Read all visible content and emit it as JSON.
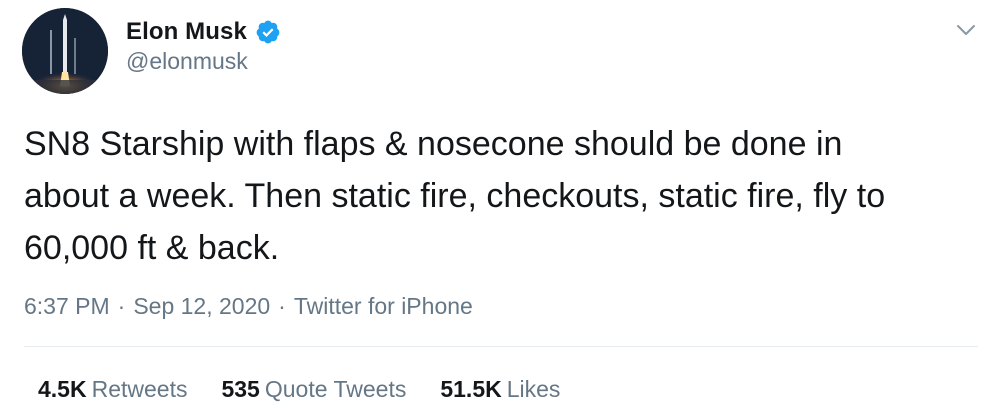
{
  "author": {
    "display_name": "Elon Musk",
    "handle": "@elonmusk",
    "verified": true,
    "avatar_icon": "rocket-launch-avatar"
  },
  "tweet": {
    "text": "SN8 Starship with flaps & nosecone should be done in\nabout a week. Then static fire, checkouts, static fire, fly to\n60,000 ft & back."
  },
  "meta": {
    "time": "6:37 PM",
    "separator": "·",
    "date": "Sep 12, 2020",
    "source": "Twitter for iPhone"
  },
  "stats": {
    "retweets": {
      "count": "4.5K",
      "label": "Retweets"
    },
    "quotes": {
      "count": "535",
      "label": "Quote Tweets"
    },
    "likes": {
      "count": "51.5K",
      "label": "Likes"
    }
  },
  "colors": {
    "text": "#14171a",
    "secondary": "#657786",
    "verified": "#1da1f2",
    "divider": "#e6ecf0"
  },
  "icons": {
    "verified": "verified-badge-icon",
    "menu": "chevron-down-icon"
  }
}
